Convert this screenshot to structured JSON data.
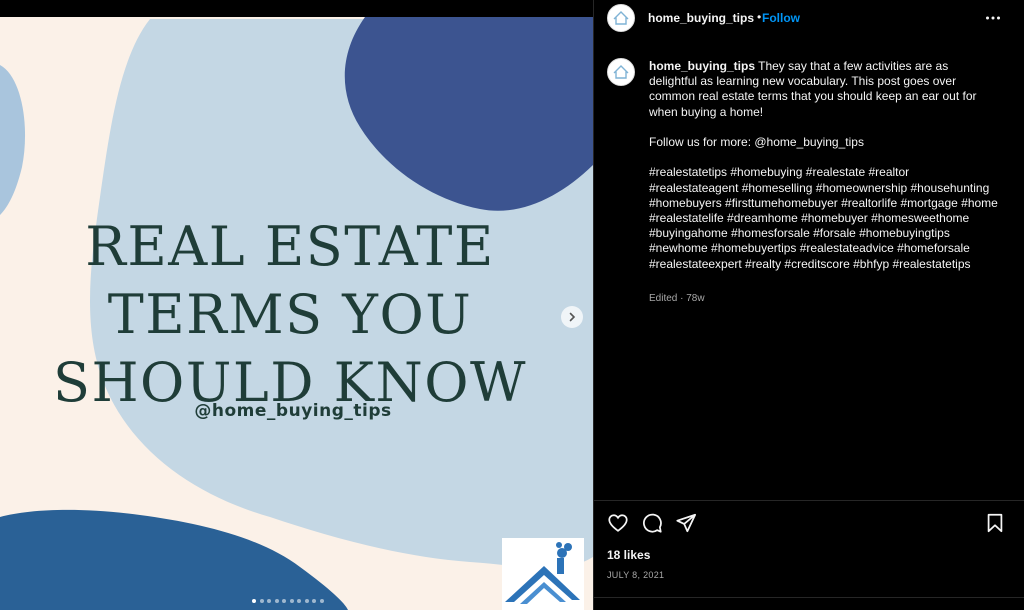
{
  "media": {
    "title": "REAL ESTATE\nTERMS YOU\nSHOULD KNOW",
    "handle": "@home_buying_tips",
    "carousel_count": 10,
    "carousel_active": 1,
    "colors": {
      "background": "#fbf1e8",
      "blob_light": "#c4d7e4",
      "blob_dark": "#3c5490",
      "blob_medium": "#2a6196",
      "blob_left": "#a9c5dd",
      "title_text": "#1f3d38"
    }
  },
  "header": {
    "username": "home_buying_tips",
    "separator": "•",
    "follow_label": "Follow",
    "more_icon": "more-horizontal-icon"
  },
  "caption": {
    "username": "home_buying_tips",
    "text": " They say that a few activities are as delightful as learning new vocabulary. This post goes over common real estate terms that you should keep an ear out for when buying a home!\n\nFollow us for more: @home_buying_tips\n\n#realestatetips #homebuying #realestate #realtor #realestateagent #homeselling #homeownership #househunting #homebuyers #firsttumehomebuyer #realtorlife #mortgage #home #realestatelife #dreamhome #homebuyer #homesweethome #buyingahome #homesforsale #forsale #homebuyingtips #newhome #homebuyertips #realestateadvice #homeforsale #realestateexpert #realty #creditscore #bhfyp #realestatetips",
    "meta": "Edited · 78w"
  },
  "actions": {
    "like_icon": "heart-icon",
    "comment_icon": "comment-icon",
    "share_icon": "send-icon",
    "save_icon": "bookmark-icon"
  },
  "likes": "18 likes",
  "date": "JULY 8, 2021",
  "accent": "#0095f6"
}
